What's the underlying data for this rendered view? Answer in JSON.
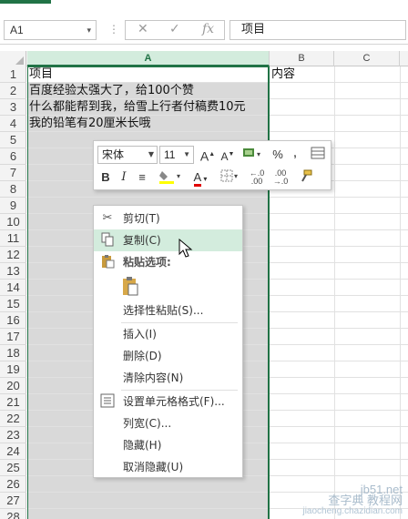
{
  "formula_bar": {
    "name_box": "A1",
    "name_box_arrow": "▾",
    "cancel_icon": "✕",
    "enter_icon": "✓",
    "fx_label": "fx",
    "value": "项目"
  },
  "columns": [
    "A",
    "B",
    "C"
  ],
  "rows": [
    "1",
    "2",
    "3",
    "4",
    "5",
    "6",
    "7",
    "8",
    "9",
    "10",
    "11",
    "12",
    "13",
    "14",
    "15",
    "16",
    "17",
    "18",
    "19",
    "20",
    "21",
    "22",
    "23",
    "24",
    "25",
    "26",
    "27",
    "28"
  ],
  "cells": {
    "a1": "项目",
    "b1": "内容",
    "a2": "百度经验太强大了，给100个赞",
    "a3": "什么都能帮到我，给雪上行者付稿费10元",
    "a4": "我的铅笔有20厘米长哦"
  },
  "mini_toolbar": {
    "font_name": "宋体",
    "font_size": "11",
    "increase_font": "A",
    "decrease_font": "A",
    "percent": "%",
    "comma": ",",
    "bold": "B",
    "italic": "I",
    "align": "≡",
    "font_color": "A",
    "inc_decimal": "←.0\n.00",
    "dec_decimal": ".00\n→.0",
    "accent_fill": "#ffff00",
    "accent_font_color": "#e00000"
  },
  "context_menu": {
    "cut": "剪切(T)",
    "copy": "复制(C)",
    "paste_header": "粘贴选项:",
    "paste_special": "选择性粘贴(S)...",
    "insert": "插入(I)",
    "delete": "删除(D)",
    "clear": "清除内容(N)",
    "format_cells": "设置单元格格式(F)...",
    "column_width": "列宽(C)...",
    "hide": "隐藏(H)",
    "unhide": "取消隐藏(U)"
  },
  "watermark": {
    "line1": "jb51.net",
    "line2": "查字典 教程网",
    "line3": "jiaocheng.chazidian.com"
  },
  "colors": {
    "excel_green": "#217346",
    "selection_gray": "#d9d9d9",
    "hover_green": "#d3ecdd"
  }
}
